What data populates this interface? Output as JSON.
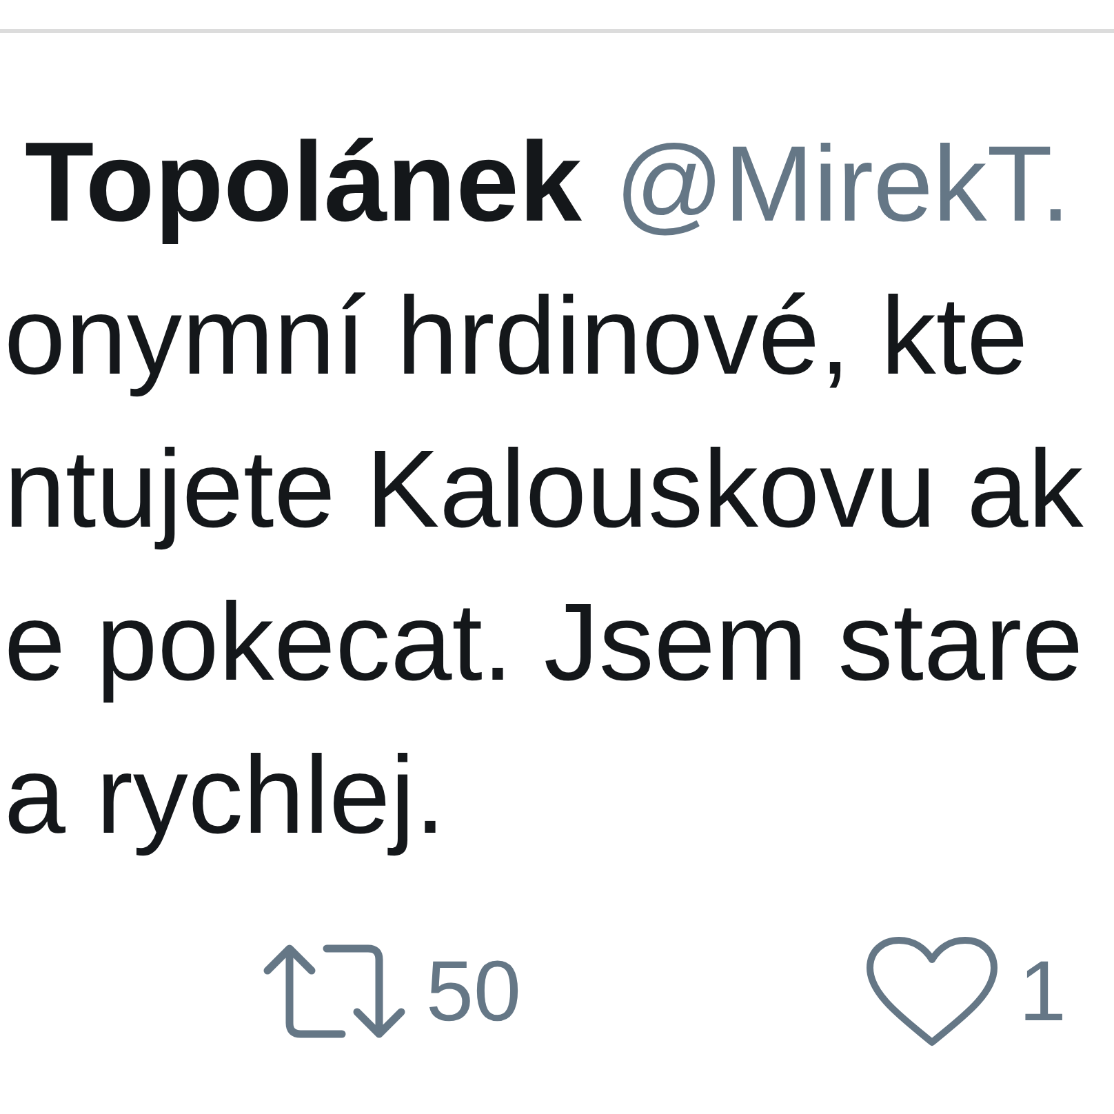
{
  "tweet": {
    "author_name": "Topolánek",
    "handle": "@MirekT.",
    "text_lines": [
      "onymní hrdinové, kte",
      "ntujete Kalouskovu ak",
      "e pokecat. Jsem stare",
      "a rychlej."
    ],
    "actions": [
      {
        "kind": "retweet",
        "count": "50"
      },
      {
        "kind": "like",
        "count": "1"
      }
    ]
  }
}
